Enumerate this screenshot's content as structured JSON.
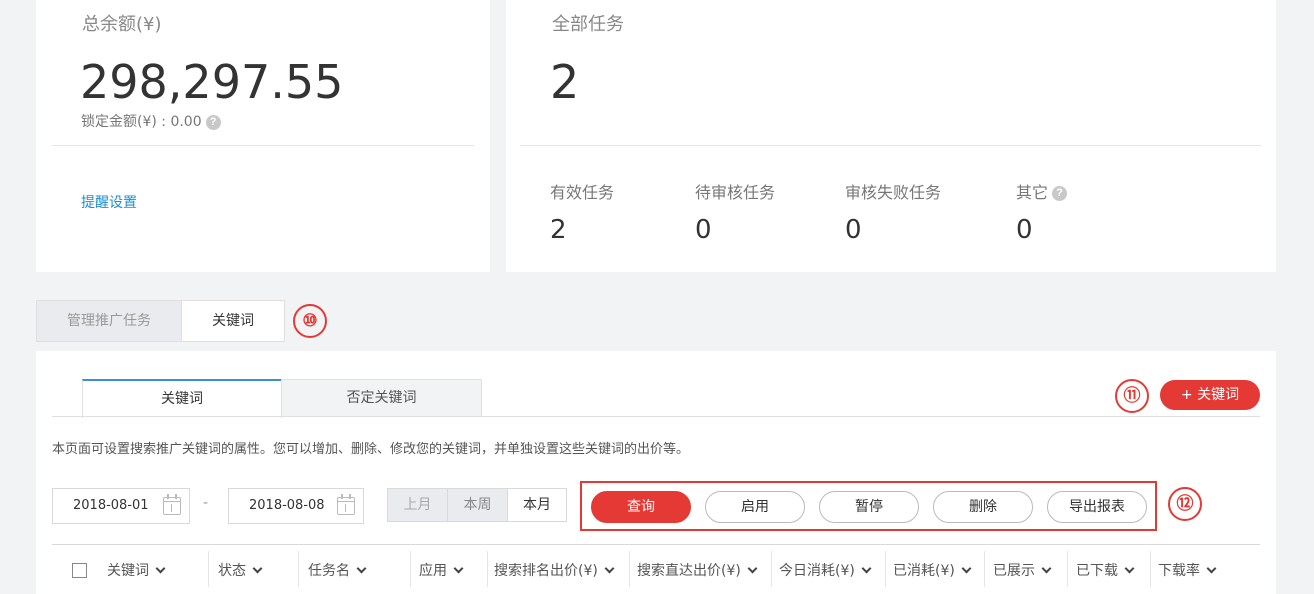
{
  "balance": {
    "title": "总余额(¥)",
    "amount": "298,297.55",
    "locked": "锁定金额(¥) : 0.00",
    "reminder_link": "提醒设置"
  },
  "tasks": {
    "title": "全部任务",
    "total": "2",
    "stats": [
      {
        "label": "有效任务",
        "value": "2"
      },
      {
        "label": "待审核任务",
        "value": "0"
      },
      {
        "label": "审核失败任务",
        "value": "0"
      },
      {
        "label": "其它",
        "value": "0"
      }
    ]
  },
  "main_tabs": {
    "manage": "管理推广任务",
    "keywords": "关键词"
  },
  "annotations": {
    "a10": "⑩",
    "a11": "⑪",
    "a12": "⑫"
  },
  "sub_tabs": {
    "keywords": "关键词",
    "negative": "否定关键词"
  },
  "add_keyword_button": "+ 关键词",
  "description": "本页面可设置搜索推广关键词的属性。您可以增加、删除、修改您的关键词，并单独设置这些关键词的出价等。",
  "date_range": {
    "start": "2018-08-01",
    "separator": "-",
    "end": "2018-08-08"
  },
  "period": {
    "last_month": "上月",
    "this_week": "本周",
    "this_month": "本月"
  },
  "actions": {
    "query": "查询",
    "enable": "启用",
    "pause": "暂停",
    "delete": "删除",
    "export": "导出报表"
  },
  "table": {
    "columns": [
      "关键词",
      "状态",
      "任务名",
      "应用",
      "搜索排名出价(¥)",
      "搜索直达出价(¥)",
      "今日消耗(¥)",
      "已消耗(¥)",
      "已展示",
      "已下载",
      "下载率"
    ]
  },
  "colors": {
    "accent_red": "#e53935",
    "link_blue": "#1a8fcf",
    "tab_blue": "#3d8fd6"
  }
}
